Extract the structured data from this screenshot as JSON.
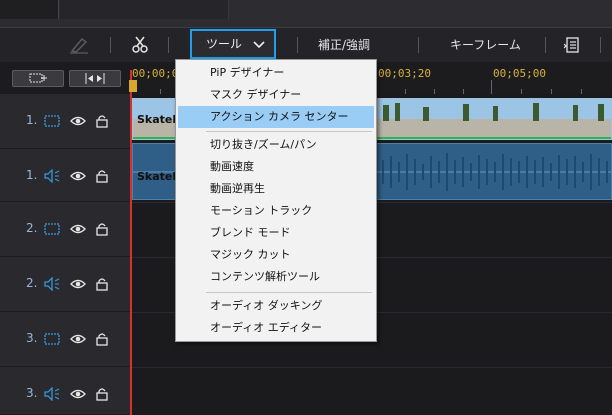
{
  "toolbar": {
    "tools_label": "ツール",
    "adjust_label": "補正/強調",
    "keyframe_label": "キーフレーム"
  },
  "ruler": {
    "timecodes": [
      "00;00;00",
      "00;03;20",
      "00;05;00"
    ]
  },
  "tracks": [
    {
      "num": "1.",
      "type": "video"
    },
    {
      "num": "1.",
      "type": "audio"
    },
    {
      "num": "2.",
      "type": "video"
    },
    {
      "num": "2.",
      "type": "audio"
    },
    {
      "num": "3.",
      "type": "video"
    },
    {
      "num": "3.",
      "type": "audio"
    }
  ],
  "clips": {
    "video_label": "Skatel",
    "audio_label": "Skatel"
  },
  "menu": {
    "items": [
      "PiP デザイナー",
      "マスク デザイナー",
      "アクション カメラ センター",
      "切り抜き/ズーム/パン",
      "動画速度",
      "動画逆再生",
      "モーション トラック",
      "ブレンド モード",
      "マジック カット",
      "コンテンツ解析ツール",
      "オーディオ ダッキング",
      "オーディオ エディター"
    ]
  },
  "colors": {
    "accent": "#1ea0f0",
    "playhead": "#d83030",
    "timecode": "#d8b13a",
    "menu_highlight": "#99cdf5"
  }
}
